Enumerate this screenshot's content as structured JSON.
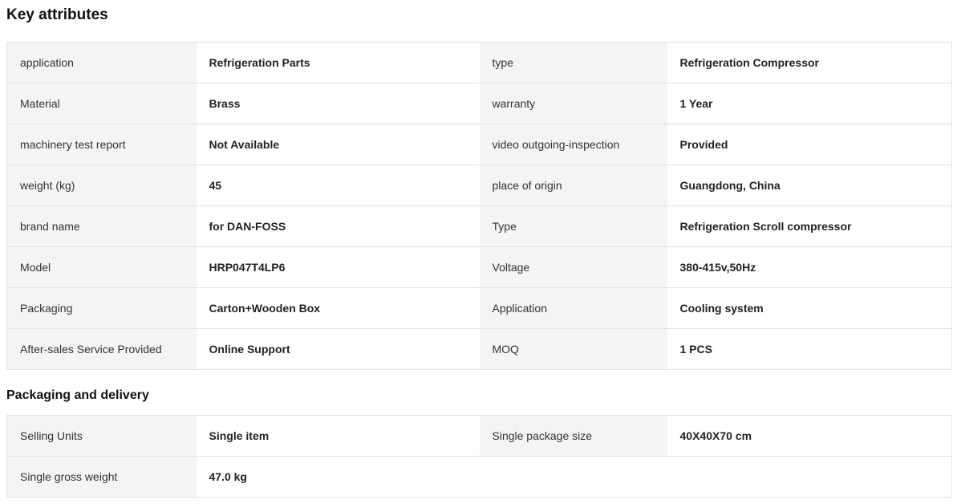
{
  "key_attributes": {
    "title": "Key attributes",
    "rows": [
      {
        "label1": "application",
        "value1": "Refrigeration Parts",
        "label2": "type",
        "value2": "Refrigeration Compressor"
      },
      {
        "label1": "Material",
        "value1": "Brass",
        "label2": "warranty",
        "value2": "1 Year"
      },
      {
        "label1": "machinery test report",
        "value1": "Not Available",
        "label2": "video outgoing-inspection",
        "value2": "Provided"
      },
      {
        "label1": "weight (kg)",
        "value1": "45",
        "label2": "place of origin",
        "value2": "Guangdong, China"
      },
      {
        "label1": "brand name",
        "value1": "for DAN-FOSS",
        "label2": "Type",
        "value2": "Refrigeration Scroll compressor"
      },
      {
        "label1": "Model",
        "value1": "HRP047T4LP6",
        "label2": "Voltage",
        "value2": "380-415v,50Hz"
      },
      {
        "label1": "Packaging",
        "value1": "Carton+Wooden Box",
        "label2": "Application",
        "value2": "Cooling system"
      },
      {
        "label1": "After-sales Service Provided",
        "value1": "Online Support",
        "label2": "MOQ",
        "value2": "1 PCS"
      }
    ]
  },
  "packaging_delivery": {
    "title": "Packaging and delivery",
    "rows": [
      {
        "label1": "Selling Units",
        "value1": "Single item",
        "label2": "Single package size",
        "value2": "40X40X70 cm"
      },
      {
        "label1": "Single gross weight",
        "value1": "47.0 kg"
      }
    ]
  },
  "colors": {
    "label_background": "#f4f4f4",
    "border": "#e2e2e2",
    "text": "#222222"
  }
}
